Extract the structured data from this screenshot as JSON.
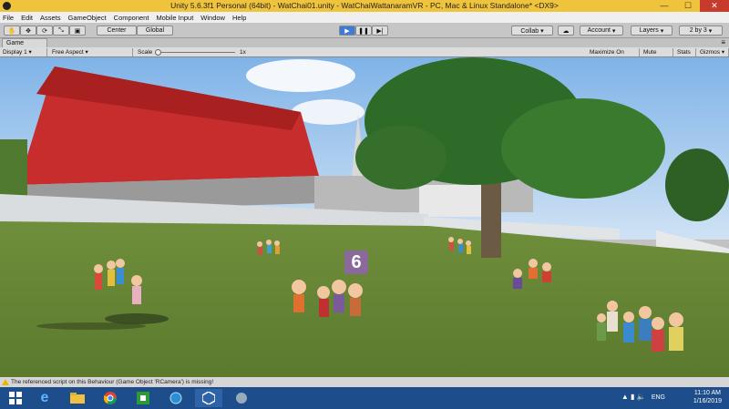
{
  "window": {
    "title": "Unity 5.6.3f1 Personal (64bit) - WatChai01.unity - WatChaiWattanaramVR - PC, Mac & Linux Standalone* <DX9>"
  },
  "menu": [
    "File",
    "Edit",
    "Assets",
    "GameObject",
    "Component",
    "Mobile Input",
    "Window",
    "Help"
  ],
  "toolbar": {
    "pivot_label": "Center",
    "space_label": "Global",
    "collab_label": "Collab ▾",
    "account_label": "Account",
    "layers_label": "Layers",
    "layout_label": "2 by 3"
  },
  "game_tab": {
    "label": "Game"
  },
  "game_bar": {
    "display": "Display 1",
    "aspect": "Free Aspect",
    "scale_label": "Scale",
    "scale_value": "1x",
    "maximize": "Maximize On Play",
    "mute": "Mute Audio",
    "stats": "Stats",
    "gizmos": "Gizmos"
  },
  "scene": {
    "sign_number": "6"
  },
  "status": {
    "message": "The referenced script on this Behaviour (Game Object 'RCamera') is missing!"
  },
  "taskbar": {
    "time": "11:10 AM",
    "date": "1/16/2019",
    "lang": "ENG"
  },
  "colors": {
    "title_bg": "#f0c33c",
    "taskbar": "#1d4d8a",
    "play": "#3d7bd4"
  }
}
